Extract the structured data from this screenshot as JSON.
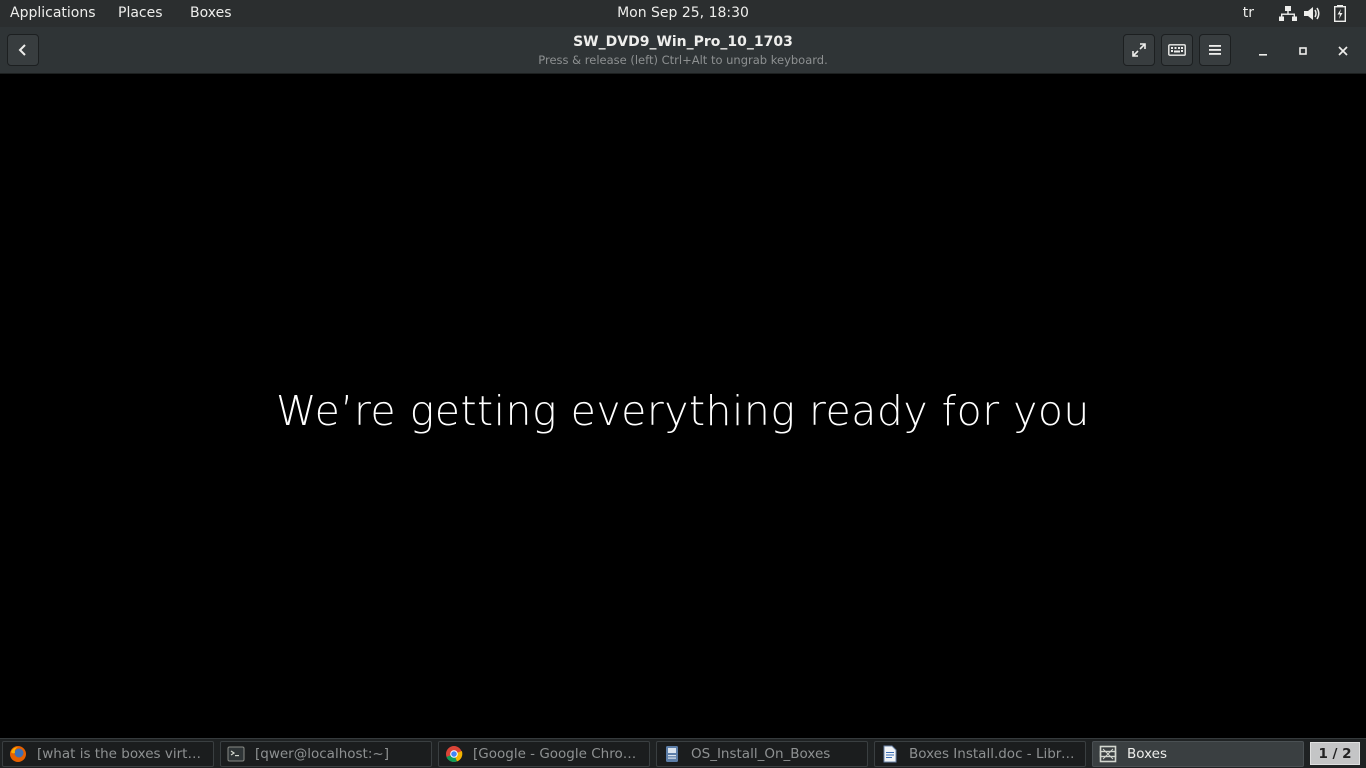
{
  "topbar": {
    "menus": [
      "Applications",
      "Places",
      "Boxes"
    ],
    "clock": "Mon Sep 25, 18:30",
    "keyboard_layout": "tr",
    "tray_icons": [
      "network-icon",
      "volume-icon",
      "battery-icon"
    ]
  },
  "headerbar": {
    "back_icon": "back-arrow-icon",
    "title": "SW_DVD9_Win_Pro_10_1703",
    "subtitle": "Press & release (left) Ctrl+Alt to ungrab keyboard.",
    "buttons": [
      "fullscreen-icon",
      "keyboard-icon",
      "menu-icon"
    ],
    "window_controls": [
      "minimize-icon",
      "maximize-icon",
      "close-icon"
    ]
  },
  "vm": {
    "message": "We’re getting everything ready for you"
  },
  "taskbar": {
    "tasks": [
      {
        "label": "[what is the boxes virtual ...",
        "icon": "firefox-icon",
        "active": false
      },
      {
        "label": "[qwer@localhost:~]",
        "icon": "terminal-icon",
        "active": false
      },
      {
        "label": "[Google - Google Chrome]",
        "icon": "chrome-icon",
        "active": false
      },
      {
        "label": "OS_Install_On_Boxes",
        "icon": "file-manager-icon",
        "active": false
      },
      {
        "label": "Boxes Install.doc - LibreO...",
        "icon": "document-icon",
        "active": false
      },
      {
        "label": "Boxes",
        "icon": "boxes-icon",
        "active": true
      }
    ],
    "workspace": "1 / 2"
  },
  "colors": {
    "topbar_bg": "#2b2e2f",
    "headerbar_bg": "#2f3436",
    "vm_bg": "#000000",
    "taskbar_bg": "#1f2223"
  }
}
